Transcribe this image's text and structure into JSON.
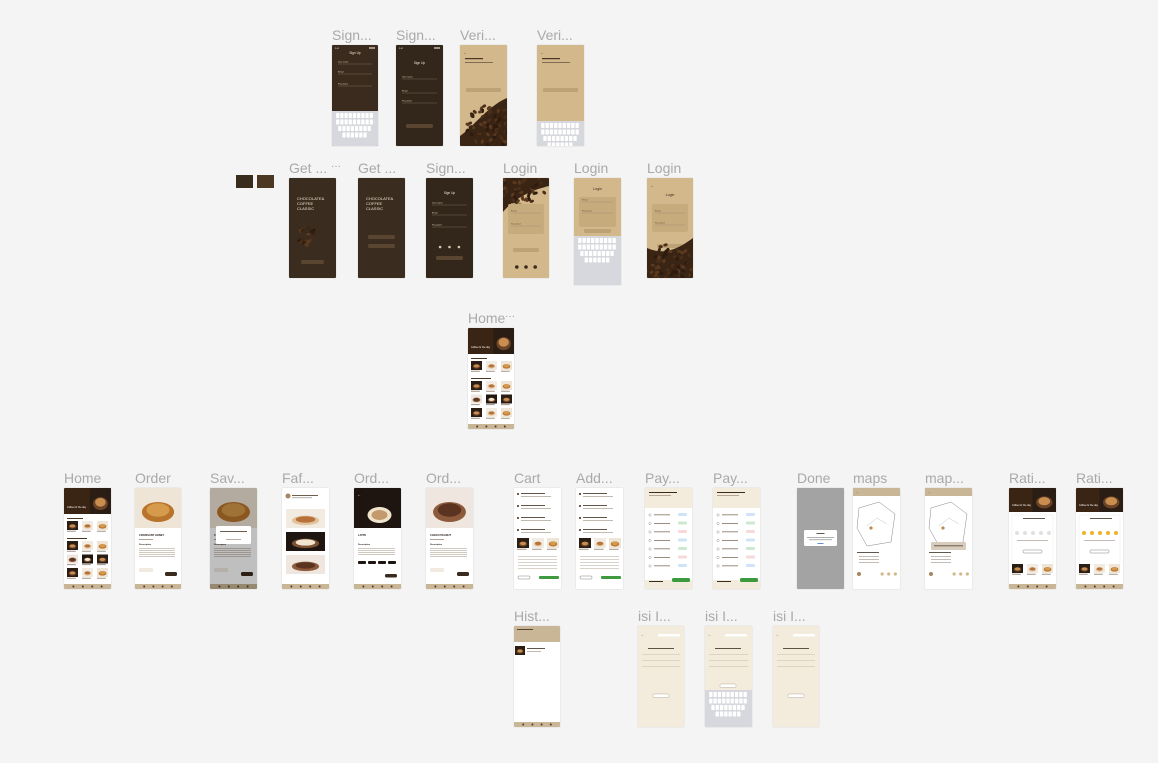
{
  "canvas": {
    "background": "#f4f4f4"
  },
  "palette": {
    "dark_brown": "#3f2f22",
    "tan": "#d2b88b",
    "cream": "#f3ecdc",
    "white": "#ffffff",
    "muted_gray": "#a3a3a3",
    "green": "#3e9a3e",
    "label_gray": "#a9a9a9"
  },
  "swatches": [
    {
      "name": "color-swatch-1",
      "color": "#3a2c1c"
    },
    {
      "name": "color-swatch-2",
      "color": "#4b3722"
    }
  ],
  "frames": [
    {
      "id": "signup-1",
      "label": "Sign...",
      "kind": "signup-keyboard",
      "title": "Sign Up"
    },
    {
      "id": "signup-2",
      "label": "Sign...",
      "kind": "signup-dark",
      "title": "Sign Up"
    },
    {
      "id": "verify-1",
      "label": "Veri...",
      "kind": "verify-beans"
    },
    {
      "id": "verify-2",
      "label": "Veri...",
      "kind": "verify-keyboard"
    },
    {
      "id": "getstarted-1",
      "label": "Get ...",
      "kind": "splash",
      "brand": "CHOCOLATE& COFFEE CLASSIC",
      "dots": "···"
    },
    {
      "id": "getstarted-2",
      "label": "Get ...",
      "kind": "splash-buttons",
      "brand": "CHOCOLATE& COFFEE CLASSIC"
    },
    {
      "id": "signup-3",
      "label": "Sign...",
      "kind": "signup-social",
      "title": "Sign Up"
    },
    {
      "id": "login-1",
      "label": "Login",
      "kind": "login-beans"
    },
    {
      "id": "login-2",
      "label": "Login",
      "kind": "login-keyboard",
      "title": "Login"
    },
    {
      "id": "login-3",
      "label": "Login",
      "kind": "login-beans-bottom",
      "title": "Login"
    },
    {
      "id": "home-main",
      "label": "Home",
      "kind": "home",
      "dots": "···"
    },
    {
      "id": "home-2",
      "label": "Home",
      "kind": "home"
    },
    {
      "id": "order",
      "label": "Order",
      "kind": "product",
      "title": "CROISSANT HONEY",
      "photo": "croissant"
    },
    {
      "id": "saved",
      "label": "Sav...",
      "kind": "product-dim",
      "photo": "croissant"
    },
    {
      "id": "favorite",
      "label": "Faf...",
      "kind": "favorites"
    },
    {
      "id": "order-latte",
      "label": "Ord...",
      "kind": "product-dark",
      "title": "LATTE",
      "photo": "latte"
    },
    {
      "id": "order-choco",
      "label": "Ord...",
      "kind": "product",
      "title": "CHOCO PEANUT",
      "photo": "choco"
    },
    {
      "id": "cart",
      "label": "Cart",
      "kind": "cart"
    },
    {
      "id": "add-cart",
      "label": "Add...",
      "kind": "cart"
    },
    {
      "id": "pay-1",
      "label": "Pay...",
      "kind": "payment"
    },
    {
      "id": "pay-2",
      "label": "Pay...",
      "kind": "payment"
    },
    {
      "id": "done",
      "label": "Done",
      "kind": "done"
    },
    {
      "id": "maps",
      "label": "maps",
      "kind": "maps"
    },
    {
      "id": "maps-2",
      "label": "map...",
      "kind": "maps-popup"
    },
    {
      "id": "rating-1",
      "label": "Rati...",
      "kind": "rating"
    },
    {
      "id": "rating-2",
      "label": "Rati...",
      "kind": "rating-gold"
    },
    {
      "id": "history",
      "label": "Hist...",
      "kind": "history"
    },
    {
      "id": "isi-1",
      "label": "isi I...",
      "kind": "form"
    },
    {
      "id": "isi-2",
      "label": "isi I...",
      "kind": "form-keyboard"
    },
    {
      "id": "isi-3",
      "label": "isi I...",
      "kind": "form"
    }
  ]
}
